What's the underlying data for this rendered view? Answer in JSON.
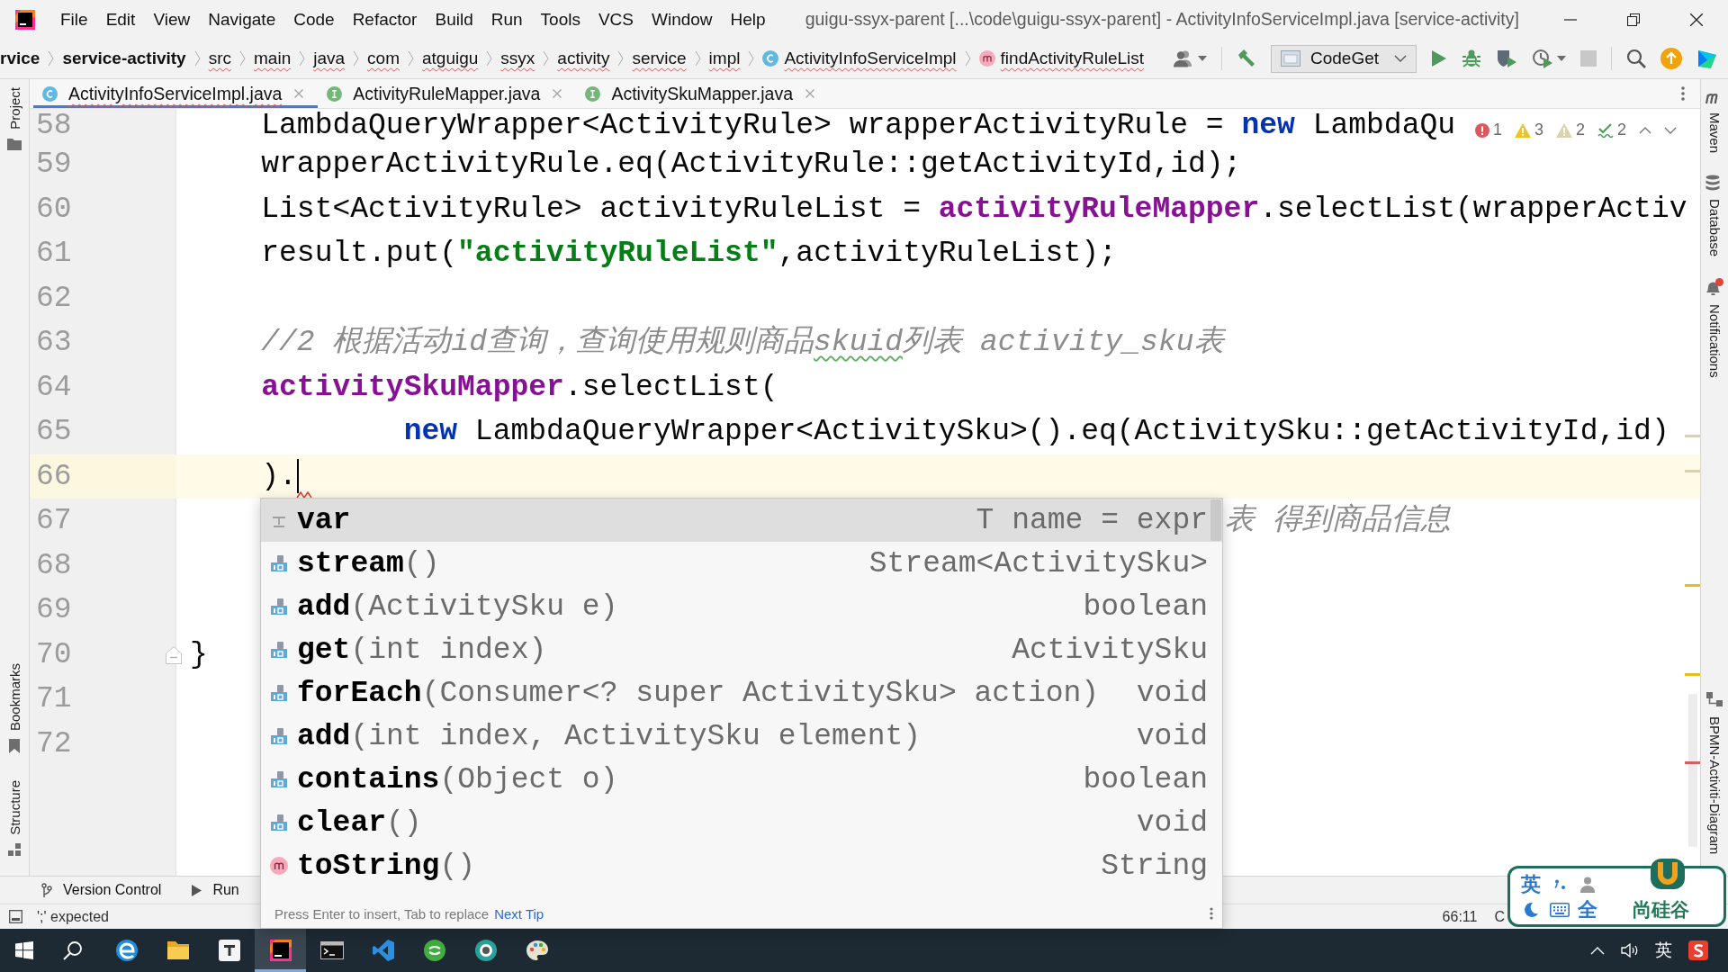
{
  "title_bar": {
    "menus": [
      "File",
      "Edit",
      "View",
      "Navigate",
      "Code",
      "Refactor",
      "Build",
      "Run",
      "Tools",
      "VCS",
      "Window",
      "Help"
    ],
    "title": "guigu-ssyx-parent [...\\code\\guigu-ssyx-parent] - ActivityInfoServiceImpl.java [service-activity]"
  },
  "breadcrumbs": [
    {
      "label": "rvice",
      "kind": "module",
      "error": false
    },
    {
      "label": "service-activity",
      "kind": "module",
      "error": false
    },
    {
      "label": "src",
      "kind": "folder",
      "error": true
    },
    {
      "label": "main",
      "kind": "folder",
      "error": true
    },
    {
      "label": "java",
      "kind": "folder",
      "error": true
    },
    {
      "label": "com",
      "kind": "folder",
      "error": true
    },
    {
      "label": "atguigu",
      "kind": "folder",
      "error": true
    },
    {
      "label": "ssyx",
      "kind": "folder",
      "error": true
    },
    {
      "label": "activity",
      "kind": "folder",
      "error": true
    },
    {
      "label": "service",
      "kind": "folder",
      "error": true
    },
    {
      "label": "impl",
      "kind": "folder",
      "error": true
    },
    {
      "label": "ActivityInfoServiceImpl",
      "kind": "class",
      "error": true
    },
    {
      "label": "findActivityRuleList",
      "kind": "method",
      "error": true
    }
  ],
  "toolbar": {
    "run_config": "CodeGet"
  },
  "tabs": [
    {
      "label": "ActivityInfoServiceImpl.java",
      "kind": "class",
      "selected": true,
      "error": true
    },
    {
      "label": "ActivityRuleMapper.java",
      "kind": "interface",
      "selected": false,
      "error": false
    },
    {
      "label": "ActivitySkuMapper.java",
      "kind": "interface",
      "selected": false,
      "error": false
    }
  ],
  "left_strip": {
    "top": [
      {
        "label": "Project",
        "kind": "project"
      }
    ],
    "bottom": [
      {
        "label": "Bookmarks",
        "kind": "bookmarks"
      },
      {
        "label": "Structure",
        "kind": "structure"
      }
    ]
  },
  "right_strip": {
    "top": [
      {
        "label": "Maven",
        "kind": "maven",
        "alert": false
      },
      {
        "label": "Database",
        "kind": "database",
        "alert": false
      },
      {
        "label": "Notifications",
        "kind": "notifications",
        "alert": true
      }
    ],
    "bottom": [
      {
        "label": "BPMN-Activiti-Diagram",
        "kind": "diagram",
        "alert": false
      }
    ]
  },
  "inspections": [
    {
      "kind": "error",
      "count": "1"
    },
    {
      "kind": "warning",
      "count": "3"
    },
    {
      "kind": "weak_warning",
      "count": "2"
    },
    {
      "kind": "typo",
      "count": "2"
    }
  ],
  "editor": {
    "lines": [
      {
        "number": "58",
        "kind": "code",
        "current": false,
        "fold": false,
        "error": false,
        "tokens": [
          {
            "kind": "plain",
            "text": "    LambdaQueryWrapper<ActivityRule> wrapperActivityRule = "
          },
          {
            "kind": "keyword",
            "text": "new"
          },
          {
            "kind": "plain",
            "text": " LambdaQu"
          }
        ]
      },
      {
        "number": "59",
        "kind": "code",
        "current": false,
        "fold": false,
        "error": false,
        "tokens": [
          {
            "kind": "plain",
            "text": "    wrapperActivityRule.eq(ActivityRule::getActivityId,id);"
          }
        ]
      },
      {
        "number": "60",
        "kind": "code",
        "current": false,
        "fold": false,
        "error": false,
        "tokens": [
          {
            "kind": "plain",
            "text": "    List<ActivityRule> activityRuleList = "
          },
          {
            "kind": "field",
            "text": "activityRuleMapper"
          },
          {
            "kind": "plain",
            "text": ".selectList(wrapperActiv"
          }
        ]
      },
      {
        "number": "61",
        "kind": "code",
        "current": false,
        "fold": false,
        "error": false,
        "tokens": [
          {
            "kind": "plain",
            "text": "    result.put("
          },
          {
            "kind": "string",
            "text": "\"activityRuleList\""
          },
          {
            "kind": "plain",
            "text": ",activityRuleList);"
          }
        ]
      },
      {
        "number": "62",
        "kind": "code",
        "current": false,
        "fold": false,
        "error": false
      },
      {
        "number": "63",
        "kind": "code",
        "current": false,
        "fold": false,
        "error": false,
        "tokens": [
          {
            "kind": "comment",
            "text": "    //2 根据活动id查询，查询使用规则商品"
          },
          {
            "kind": "comment_typo",
            "text": "skuid"
          },
          {
            "kind": "comment",
            "text": "列表 activity_sku表"
          }
        ]
      },
      {
        "number": "64",
        "kind": "code",
        "current": false,
        "fold": false,
        "error": false,
        "tokens": [
          {
            "kind": "field",
            "text": "    activitySkuMapper"
          },
          {
            "kind": "plain",
            "text": ".selectList("
          }
        ]
      },
      {
        "number": "65",
        "kind": "code",
        "current": false,
        "fold": false,
        "error": false,
        "tokens": [
          {
            "kind": "keyword",
            "text": "            new"
          },
          {
            "kind": "plain",
            "text": " LambdaQueryWrapper<ActivitySku>().eq(ActivitySku::getActivityId,id)"
          }
        ]
      },
      {
        "number": "66",
        "kind": "code",
        "current": true,
        "fold": false,
        "error": true,
        "tokens": [
          {
            "kind": "plain",
            "text": "    )."
          }
        ]
      },
      {
        "number": "67",
        "kind": "covered",
        "current": false,
        "fold": false,
        "error": false,
        "tokens": [
          {
            "kind": "comment",
            "text": "表 得到商品信息"
          }
        ]
      },
      {
        "number": "68",
        "kind": "code",
        "current": false,
        "fold": false,
        "error": false
      },
      {
        "number": "69",
        "kind": "code",
        "current": false,
        "fold": false,
        "error": false
      },
      {
        "number": "70",
        "kind": "code",
        "current": false,
        "fold": true,
        "error": false,
        "tokens": [
          {
            "kind": "plain",
            "text": "}"
          }
        ]
      },
      {
        "number": "71",
        "kind": "code",
        "current": false,
        "fold": false,
        "error": false
      },
      {
        "number": "72",
        "kind": "code",
        "current": false,
        "fold": false,
        "error": false
      }
    ]
  },
  "completion": {
    "items": [
      {
        "kind": "template",
        "name": "var",
        "type": "T name = expr",
        "selected": true
      },
      {
        "kind": "library_method",
        "name": "stream",
        "params": "()",
        "type": "Stream<ActivitySku>",
        "selected": false
      },
      {
        "kind": "library_method",
        "name": "add",
        "params": "(ActivitySku e)",
        "type": "boolean",
        "selected": false
      },
      {
        "kind": "library_method",
        "name": "get",
        "params": "(int index)",
        "type": "ActivitySku",
        "selected": false
      },
      {
        "kind": "library_method",
        "name": "forEach",
        "params": "(Consumer<? super ActivitySku> action)",
        "type": "void",
        "selected": false
      },
      {
        "kind": "library_method",
        "name": "add",
        "params": "(int index, ActivitySku element)",
        "type": "void",
        "selected": false
      },
      {
        "kind": "library_method",
        "name": "contains",
        "params": "(Object o)",
        "type": "boolean",
        "selected": false
      },
      {
        "kind": "library_method",
        "name": "clear",
        "params": "()",
        "type": "void",
        "selected": false
      },
      {
        "kind": "method",
        "name": "toString",
        "params": "()",
        "type": "String",
        "selected": false
      }
    ],
    "hint": "Press Enter to insert, Tab to replace",
    "link": "Next Tip"
  },
  "tool_windows": [
    {
      "label": "Version Control",
      "kind": "vcs"
    },
    {
      "label": "Run",
      "kind": "run"
    }
  ],
  "status_bar": {
    "message": "';' expected",
    "position": "66:11",
    "encoding": "C"
  },
  "ime": {
    "language": "英",
    "width": "全",
    "brand": "尚硅谷"
  },
  "taskbar": {
    "apps": [
      {
        "kind": "browser",
        "selected": false
      },
      {
        "kind": "files",
        "selected": false
      },
      {
        "kind": "notes",
        "selected": false
      },
      {
        "kind": "ide",
        "selected": true
      },
      {
        "kind": "terminal",
        "selected": false
      },
      {
        "kind": "code_editor",
        "selected": false
      },
      {
        "kind": "green_app",
        "selected": false
      },
      {
        "kind": "round_app",
        "selected": false
      },
      {
        "kind": "palette",
        "selected": false
      }
    ],
    "language": "英"
  }
}
